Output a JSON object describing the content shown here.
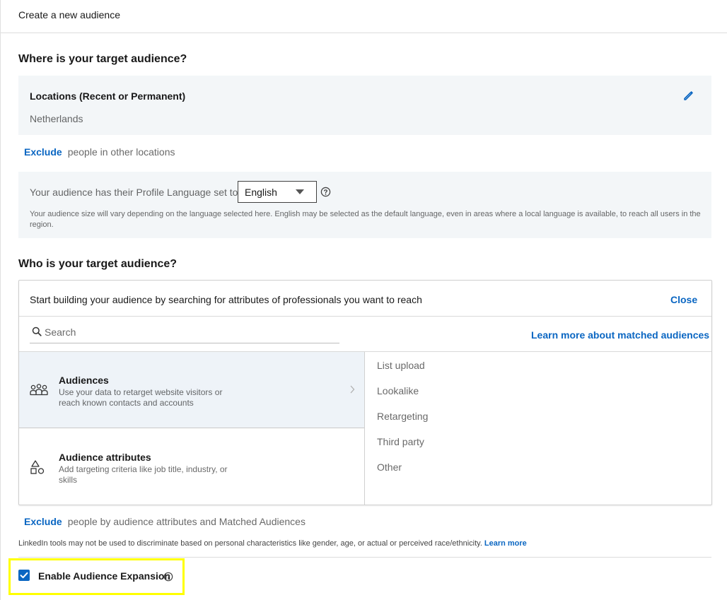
{
  "header": {
    "title": "Create a new audience"
  },
  "where": {
    "title": "Where is your target audience?",
    "locations_label": "Locations (Recent or Permanent)",
    "locations_value": "Netherlands",
    "exclude_link": "Exclude",
    "exclude_text": "people in other locations"
  },
  "language": {
    "label": "Your audience has their Profile Language set to",
    "selected": "English",
    "note": "Your audience size will vary depending on the language selected here. English may be selected as the default language, even in areas where a local language is available, to reach all users in the region."
  },
  "who": {
    "title": "Who is your target audience?",
    "intro": "Start building your audience by searching for attributes of professionals you want to reach",
    "close_label": "Close",
    "search_placeholder": "Search",
    "learn_more_matched": "Learn more about matched audiences",
    "categories": [
      {
        "title": "Audiences",
        "desc": "Use your data to retarget website visitors or reach known contacts and accounts"
      },
      {
        "title": "Audience attributes",
        "desc": "Add targeting criteria like job title, industry, or skills"
      }
    ],
    "sub_items": [
      "List upload",
      "Lookalike",
      "Retargeting",
      "Third party",
      "Other"
    ],
    "exclude_link": "Exclude",
    "exclude_text": "people by audience attributes and Matched Audiences"
  },
  "legal": {
    "text": "LinkedIn tools may not be used to discriminate based on personal characteristics like gender, age, or actual or perceived race/ethnicity.",
    "link": "Learn more"
  },
  "expansion": {
    "label": "Enable Audience Expansion",
    "checked": true
  },
  "colors": {
    "accent": "#0a66c2",
    "panel_bg": "#f3f6f8",
    "highlight": "#ffff00"
  },
  "icons": [
    "pencil-icon",
    "caret-down-icon",
    "help-icon",
    "search-icon",
    "people-icon",
    "shapes-icon",
    "chevron-right-icon",
    "checkmark-icon"
  ]
}
